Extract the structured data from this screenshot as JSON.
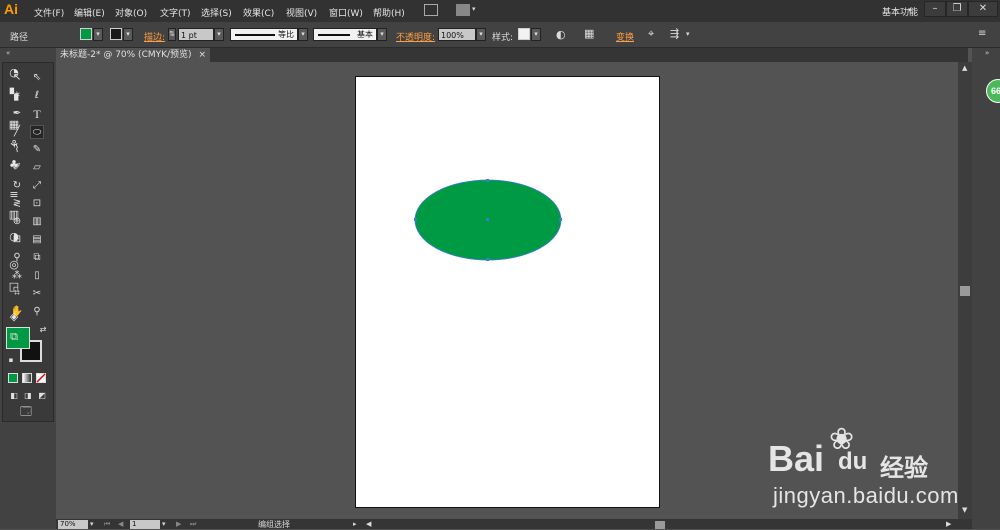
{
  "app": {
    "logo": "Ai",
    "menus": [
      "文件(F)",
      "编辑(E)",
      "对象(O)",
      "文字(T)",
      "选择(S)",
      "效果(C)",
      "视图(V)",
      "窗口(W)",
      "帮助(H)"
    ],
    "workspace": "基本功能"
  },
  "control": {
    "selection_label": "路径",
    "stroke_label": "描边:",
    "stroke_weight": "1 pt",
    "profile_label": "等比",
    "brush_label": "基本",
    "opacity_label": "不透明度:",
    "opacity_value": "100%",
    "style_label": "样式:",
    "transform_label": "变换"
  },
  "colors": {
    "fill": "#009a44",
    "accent": "#ff9f40"
  },
  "document": {
    "tab_title": "未标题-2* @ 70% (CMYK/预览)",
    "close_glyph": "×"
  },
  "status": {
    "zoom": "70%",
    "artboard_no": "1",
    "tool_state": "编组选择"
  },
  "dock": {
    "badge": "66"
  },
  "watermark": {
    "bai": "Bai",
    "du": "du",
    "jingyan": "经验",
    "url": "jingyan.baidu.com"
  }
}
